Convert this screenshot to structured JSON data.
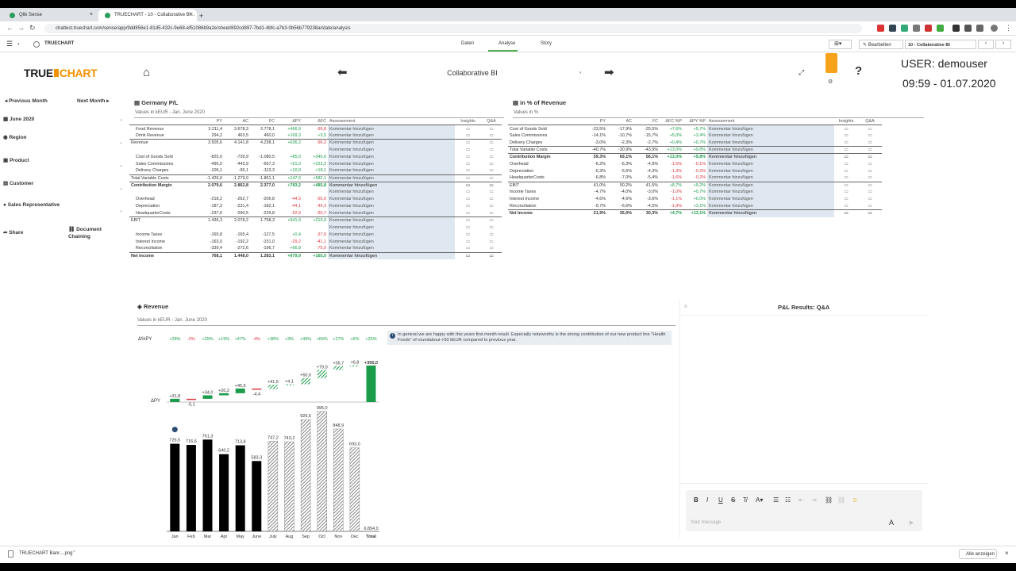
{
  "browser": {
    "tabs": [
      {
        "title": "Qlik Sense"
      },
      {
        "title": "TRUECHART - 10 - Collaborative BI..."
      }
    ],
    "url": "chattest.truechart.com/sense/app/9dd856e1-81d5-432c-9e68-ef51086b9a2e/sheet/892cd897-7bd1-4bfc-a7b3-0b56b779238a/state/analysis"
  },
  "qlik": {
    "app_name": "TRUECHART",
    "nav_tabs": [
      "Daten",
      "Analyse",
      "Story"
    ],
    "edit_label": "Bearbeiten",
    "sheet_name": "10 - Collaborative BI"
  },
  "header": {
    "logo_text": "TRUE",
    "logo_text_accent": "CHART",
    "title": "Collaborative BI",
    "user": "USER: demouser",
    "datetime": "09:59 - 01.07.2020"
  },
  "sidebar": {
    "prev": "Previous Month",
    "next": "Next Month",
    "items": [
      "June 2020",
      "Region",
      "Product",
      "Customer",
      "Sales Representative"
    ],
    "share": "Share",
    "doc": "Document Chaining"
  },
  "pl": {
    "title": "Germany P/L",
    "subtitle": "Values in kEUR - Jan. June 2020",
    "headers": [
      "PY",
      "AC",
      "FC",
      "ΔPY",
      "ΔFC",
      "Assessement",
      "Insights",
      "Q&A"
    ],
    "rows": [
      {
        "label": "Food Revenue",
        "py": "3.211,4",
        "ac": "3.678,3",
        "fc": "3.778,1",
        "dpy": "+466,9",
        "dfc": "-99,8",
        "ind": 1
      },
      {
        "label": "Drink Revenue",
        "py": "294,2",
        "ac": "463,5",
        "fc": "460,0",
        "dpy": "+169,3",
        "dfc": "+3,5",
        "ind": 1
      },
      {
        "label": "Revenue",
        "py": "3.505,6",
        "ac": "4.141,8",
        "fc": "4.238,1",
        "dpy": "+636,2",
        "dfc": "-96,3",
        "ind": 0,
        "rule": 1
      },
      {
        "label": "",
        "blank": 1
      },
      {
        "label": "Cost of Goods Sold",
        "py": "-825,0",
        "ac": "-739,9",
        "fc": "-1.080,5",
        "dpy": "+85,0",
        "dfc": "+340,6",
        "ind": 1
      },
      {
        "label": "Sales Commissions",
        "py": "-495,0",
        "ac": "-443,9",
        "fc": "-667,3",
        "dpy": "+51,0",
        "dfc": "+223,3",
        "ind": 1
      },
      {
        "label": "Delivery Charges",
        "py": "-106,1",
        "ac": "-95,1",
        "fc": "-113,3",
        "dpy": "+10,9",
        "dfc": "+18,1",
        "ind": 1
      },
      {
        "label": "Total Variable Costs",
        "py": "-1.426,0",
        "ac": "-1.279,0",
        "fc": "-1.861,1",
        "dpy": "+147,0",
        "dfc": "+582,1",
        "ind": 0,
        "rule": 1
      },
      {
        "label": "Contribution Margin",
        "py": "2.079,6",
        "ac": "2.862,8",
        "fc": "2.377,0",
        "dpy": "+783,2",
        "dfc": "+485,8",
        "ind": 0,
        "bold": 1,
        "rule": 1
      },
      {
        "label": "",
        "blank": 1
      },
      {
        "label": "Overhead",
        "py": "-218,2",
        "ac": "-262,7",
        "fc": "-206,8",
        "dpy": "-44,5",
        "dfc": "-55,9",
        "ind": 1
      },
      {
        "label": "Depreciation",
        "py": "-187,3",
        "ac": "-231,4",
        "fc": "-182,1",
        "dpy": "-44,1",
        "dfc": "-49,3",
        "ind": 1
      },
      {
        "label": "HeadquarterCosts",
        "py": "-237,6",
        "ac": "-290,5",
        "fc": "-229,8",
        "dpy": "-52,9",
        "dfc": "-60,7",
        "ind": 1
      },
      {
        "label": "EBIT",
        "py": "1.436,3",
        "ac": "2.078,2",
        "fc": "1.758,3",
        "dpy": "+641,9",
        "dfc": "+319,9",
        "ind": 0,
        "rule": 1
      },
      {
        "label": "",
        "blank": 1
      },
      {
        "label": "Income Taxes",
        "py": "-165,8",
        "ac": "-165,4",
        "fc": "-127,5",
        "dpy": "+0,4",
        "dfc": "-37,9",
        "ind": 1
      },
      {
        "label": "Interest Income",
        "py": "-163,0",
        "ac": "-192,2",
        "fc": "-151,0",
        "dpy": "-29,2",
        "dfc": "-41,1",
        "ind": 1
      },
      {
        "label": "Reconciliation",
        "py": "-339,4",
        "ac": "-272,6",
        "fc": "-196,7",
        "dpy": "+66,8",
        "dfc": "-75,9",
        "ind": 1
      },
      {
        "label": "Net Income",
        "py": "768,1",
        "ac": "1.448,0",
        "fc": "1.283,1",
        "dpy": "+679,9",
        "dfc": "+165,0",
        "ind": 0,
        "bold": 1,
        "rule": 1
      }
    ],
    "assessment_text": "Kommentar hinzufügen"
  },
  "pct": {
    "title": "in % of Revenue",
    "subtitle": "Values in %",
    "headers": [
      "PY",
      "AC",
      "FC",
      "ΔFC %P",
      "ΔPY %P",
      "Assessement",
      "Insights",
      "Q&A"
    ],
    "rows": [
      {
        "label": "Cost of Goods Sold",
        "py": "-23,5%",
        "ac": "-17,9%",
        "fc": "-25,5%",
        "d1": "+7,6%",
        "d2": "+5,7%"
      },
      {
        "label": "Sales Commissions",
        "py": "-14,1%",
        "ac": "-10,7%",
        "fc": "-15,7%",
        "d1": "+5,0%",
        "d2": "+3,4%"
      },
      {
        "label": "Delivery Charges",
        "py": "-3,0%",
        "ac": "-2,3%",
        "fc": "-2,7%",
        "d1": "+0,4%",
        "d2": "+0,7%"
      },
      {
        "label": "Total Variable Costs",
        "py": "-40,7%",
        "ac": "-30,9%",
        "fc": "-43,9%",
        "d1": "+13,0%",
        "d2": "+9,8%",
        "rule": 1
      },
      {
        "label": "Contribution Margin",
        "py": "59,3%",
        "ac": "69,1%",
        "fc": "56,1%",
        "d1": "+13,0%",
        "d2": "+9,8%",
        "bold": 1,
        "rule": 1
      },
      {
        "label": "Overhead",
        "py": "-6,2%",
        "ac": "-6,3%",
        "fc": "-4,9%",
        "d1": "-1,5%",
        "d2": "-0,1%"
      },
      {
        "label": "Depreciation",
        "py": "-5,3%",
        "ac": "-5,6%",
        "fc": "-4,3%",
        "d1": "-1,3%",
        "d2": "-0,2%"
      },
      {
        "label": "HeadquarterCosts",
        "py": "-6,8%",
        "ac": "-7,0%",
        "fc": "-5,4%",
        "d1": "-1,6%",
        "d2": "-0,2%"
      },
      {
        "label": "EBIT",
        "py": "41,0%",
        "ac": "50,2%",
        "fc": "41,5%",
        "d1": "+8,7%",
        "d2": "+9,2%",
        "rule": 1
      },
      {
        "label": "Income Taxes",
        "py": "-4,7%",
        "ac": "-4,0%",
        "fc": "-3,0%",
        "d1": "-1,0%",
        "d2": "+0,7%"
      },
      {
        "label": "Interest Income",
        "py": "-4,6%",
        "ac": "-4,6%",
        "fc": "-3,6%",
        "d1": "-1,1%",
        "d2": "+0,0%"
      },
      {
        "label": "Reconciliation",
        "py": "-9,7%",
        "ac": "-6,6%",
        "fc": "-4,5%",
        "d1": "-1,9%",
        "d2": "+3,1%"
      },
      {
        "label": "Net Income",
        "py": "21,9%",
        "ac": "35,0%",
        "fc": "30,3%",
        "d1": "+4,7%",
        "d2": "+13,1%",
        "bold": 1,
        "rule": 1
      }
    ]
  },
  "revenue": {
    "title": "Revenue",
    "subtitle": "Values in kEUR - Jan. June 2020",
    "delta_label": "Δ%PY",
    "py_label": "ΔPY",
    "note": "In general we are happy with this years first month result. Especially noteworthy is the strong contribution of our new product line \"Health Foods\" of roundabout +50 kEUR compared to previous year."
  },
  "chart_data": {
    "type": "bar",
    "categories": [
      "Jan",
      "Feb",
      "Mar",
      "Apr",
      "May",
      "June",
      "July",
      "Aug",
      "Sep",
      "Oct",
      "Nov",
      "Dec",
      "Total"
    ],
    "values": [
      726.5,
      716.6,
      761.3,
      640.2,
      713.8,
      583.3,
      747.2,
      743.2,
      926.6,
      995.0,
      848.9,
      693.0,
      6854.0
    ],
    "value_labels": [
      "726,5",
      "716,6",
      "761,3",
      "640,2",
      "713,8",
      "583,3",
      "747,2",
      "743,2",
      "926,6",
      "995,0",
      "848,9",
      "693,0",
      "6.854,0"
    ],
    "actual_months": 6,
    "delta_pct": [
      "+28%",
      "-0%",
      "+29%",
      "+19%",
      "+47%",
      "-4%",
      "+38%",
      "+3%",
      "+49%",
      "+66%",
      "+27%",
      "+6%",
      "+25%"
    ],
    "delta_py": [
      31.8,
      -0.1,
      34.0,
      20.2,
      45.6,
      -4.4,
      41.5,
      4.1,
      60.6,
      79.0,
      36.7,
      6.8,
      355.0
    ],
    "delta_py_labels": [
      "+31,8",
      "-0,1",
      "+34,0",
      "+20,2",
      "+45,6",
      "-4,4",
      "+41,5",
      "+4,1",
      "+60,6",
      "+79,0",
      "+36,7",
      "+6,8",
      "+355,0"
    ],
    "colors": {
      "actual": "#000000",
      "forecast": "#a0a0a0",
      "pos": "#1a9c4a",
      "neg": "#d9363e"
    }
  },
  "qa": {
    "title": "P&L Results: Q&A",
    "placeholder": "Your message"
  },
  "download": {
    "file": "TRUECHART Banr....png",
    "show_all": "Alle anzeigen"
  }
}
